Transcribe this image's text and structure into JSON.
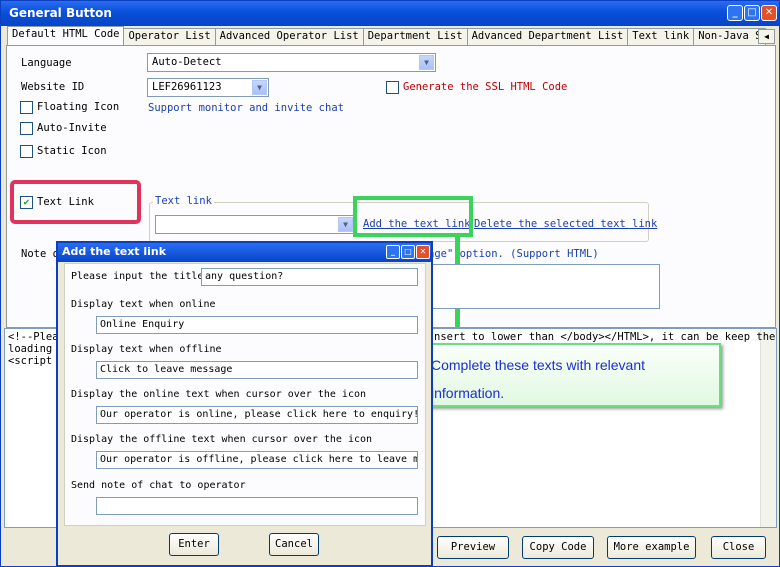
{
  "window": {
    "title": "General Button"
  },
  "tabs": [
    "Default HTML Code",
    "Operator List",
    "Advanced Operator List",
    "Department List",
    "Advanced Department List",
    "Text link",
    "Non-Java S"
  ],
  "form": {
    "language_label": "Language",
    "language_value": "Auto-Detect",
    "website_label": "Website ID",
    "website_value": "LEF26961123",
    "ssl_label": "Generate the SSL HTML Code",
    "floating_label": "Floating Icon",
    "support_text": "Support monitor and invite chat",
    "autoinvite_label": "Auto-Invite",
    "static_label": "Static Icon",
    "textlink_label": "Text Link",
    "textlink_group": "Text link",
    "add_link": "Add the text link",
    "delete_link": "Delete the selected text link",
    "note_prefix": "Note o",
    "note_suffix": "age\" option. (Support HTML)"
  },
  "code": {
    "line1_left": "<!--Plea",
    "line1_right": "nsert to lower than </body></HTML>, it can be keep the",
    "line2": "loading",
    "line3": "<script"
  },
  "buttons": {
    "preview": "Preview",
    "copy": "Copy Code",
    "more": "More example",
    "close": "Close"
  },
  "dialog": {
    "title": "Add the text link",
    "title_label": "Please input the title",
    "title_value": "any question?",
    "online_label": "Display text when online",
    "online_value": "Online Enquiry",
    "offline_label": "Display text when offline",
    "offline_value": "Click to leave message",
    "online_hover_label": "Display the online text when cursor over the icon",
    "online_hover_value": "Our operator is online, please click here to enquiry!",
    "offline_hover_label": "Display the offline text when cursor over the icon",
    "offline_hover_value": "Our operator is offline, please click here to leave message",
    "note_label": "Send note of chat to operator",
    "note_value": "",
    "enter": "Enter",
    "cancel": "Cancel"
  },
  "callout": {
    "text": "Complete these texts with relevant information."
  },
  "colors": {
    "highlight_red": "#e0335b",
    "highlight_green": "#3cd35a",
    "link_blue": "#1b3fb0"
  }
}
